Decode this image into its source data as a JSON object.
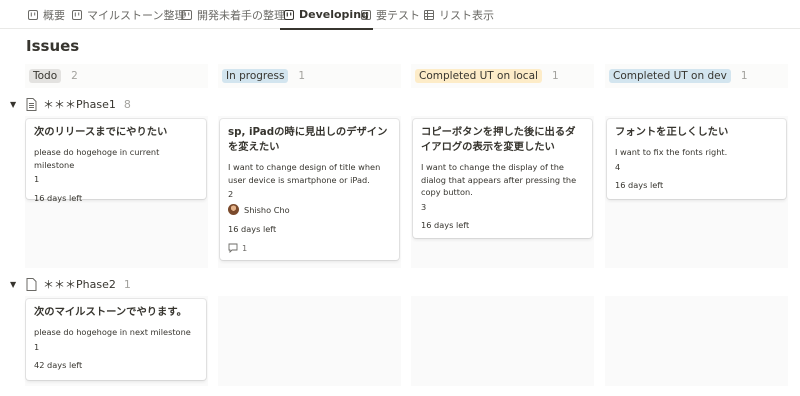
{
  "tabs": [
    {
      "label": "概要",
      "icon": "board-icon"
    },
    {
      "label": "マイルストーン整理",
      "icon": "board-icon"
    },
    {
      "label": "開発未着手の整理",
      "icon": "board-icon"
    },
    {
      "label": "Developing",
      "icon": "board-icon",
      "active": true
    },
    {
      "label": "要テスト",
      "icon": "board-icon"
    },
    {
      "label": "リスト表示",
      "icon": "table-icon"
    }
  ],
  "title": "Issues",
  "columns": [
    {
      "label": "Todo",
      "count": "2",
      "color": "#e3e2e0"
    },
    {
      "label": "In progress",
      "count": "1",
      "color": "#d3e5ef"
    },
    {
      "label": "Completed UT on local",
      "count": "1",
      "color": "#fdecc8"
    },
    {
      "label": "Completed UT on dev",
      "count": "1",
      "color": "#d3e5ef"
    }
  ],
  "groups": [
    {
      "title": "＊＊＊Phase1",
      "count": "8"
    },
    {
      "title": "＊＊＊Phase2",
      "count": "1"
    }
  ],
  "cards": {
    "p1_todo": {
      "title": "次のリリースまでにやりたい",
      "desc": "please do hogehoge in current milestone",
      "num": "1",
      "due": "16 days left"
    },
    "p1_prog": {
      "title": "sp, iPadの時に見出しのデザインを変えたい",
      "desc": "I want to change design of title when user device is smartphone or iPad.",
      "num": "2",
      "user": "Shisho Cho",
      "due": "16 days left",
      "comments": "1"
    },
    "p1_local": {
      "title": "コピーボタンを押した後に出るダイアログの表示を変更したい",
      "desc": "I want to change the display of the dialog that appears after pressing the copy button.",
      "num": "3",
      "due": "16 days left"
    },
    "p1_dev": {
      "title": "フォントを正しくしたい",
      "desc": "I want to fix the fonts right.",
      "num": "4",
      "due": "16 days left"
    },
    "p2_todo": {
      "title": "次のマイルストーンでやります。",
      "desc": "please do hogehoge in next milestone",
      "num": "1",
      "due": "42 days left"
    }
  }
}
